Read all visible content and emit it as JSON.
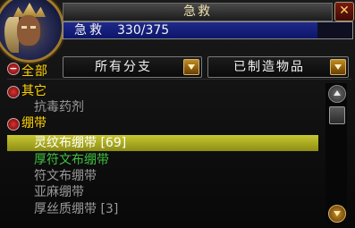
{
  "window": {
    "title": "急救",
    "close_symbol": "✕"
  },
  "skill": {
    "name": "急救",
    "value": "330/375",
    "progress": 0.88
  },
  "filters": {
    "collapse_all_symbol": "−",
    "all_label": "全部",
    "subclass_dropdown": "所有分支",
    "slot_dropdown": "已制造物品"
  },
  "list": [
    {
      "type": "category",
      "label": "其它"
    },
    {
      "type": "recipe",
      "label": "抗毒药剂",
      "difficulty": "trivial"
    },
    {
      "type": "category",
      "label": "绷带"
    },
    {
      "type": "recipe",
      "label": "灵纹布绷带 [69]",
      "difficulty": "easy",
      "selected": true
    },
    {
      "type": "recipe",
      "label": "厚符文布绷带",
      "difficulty": "medium"
    },
    {
      "type": "recipe",
      "label": "符文布绷带",
      "difficulty": "trivial"
    },
    {
      "type": "recipe",
      "label": "亚麻绷带",
      "difficulty": "trivial"
    },
    {
      "type": "recipe",
      "label": "厚丝质绷带 [3]",
      "difficulty": "trivial"
    }
  ],
  "colors": {
    "category": "#ffd100",
    "selected_bg": "#b4b42a",
    "medium": "#40c040",
    "trivial": "#9a9a9a",
    "skill_bar": "#1a2480"
  },
  "icons": {
    "portrait": "character-portrait",
    "close": "close-icon",
    "collapse": "minus-icon",
    "dropdown": "chevron-down-icon",
    "scroll_up": "scroll-up-icon",
    "scroll_down": "scroll-down-icon"
  }
}
